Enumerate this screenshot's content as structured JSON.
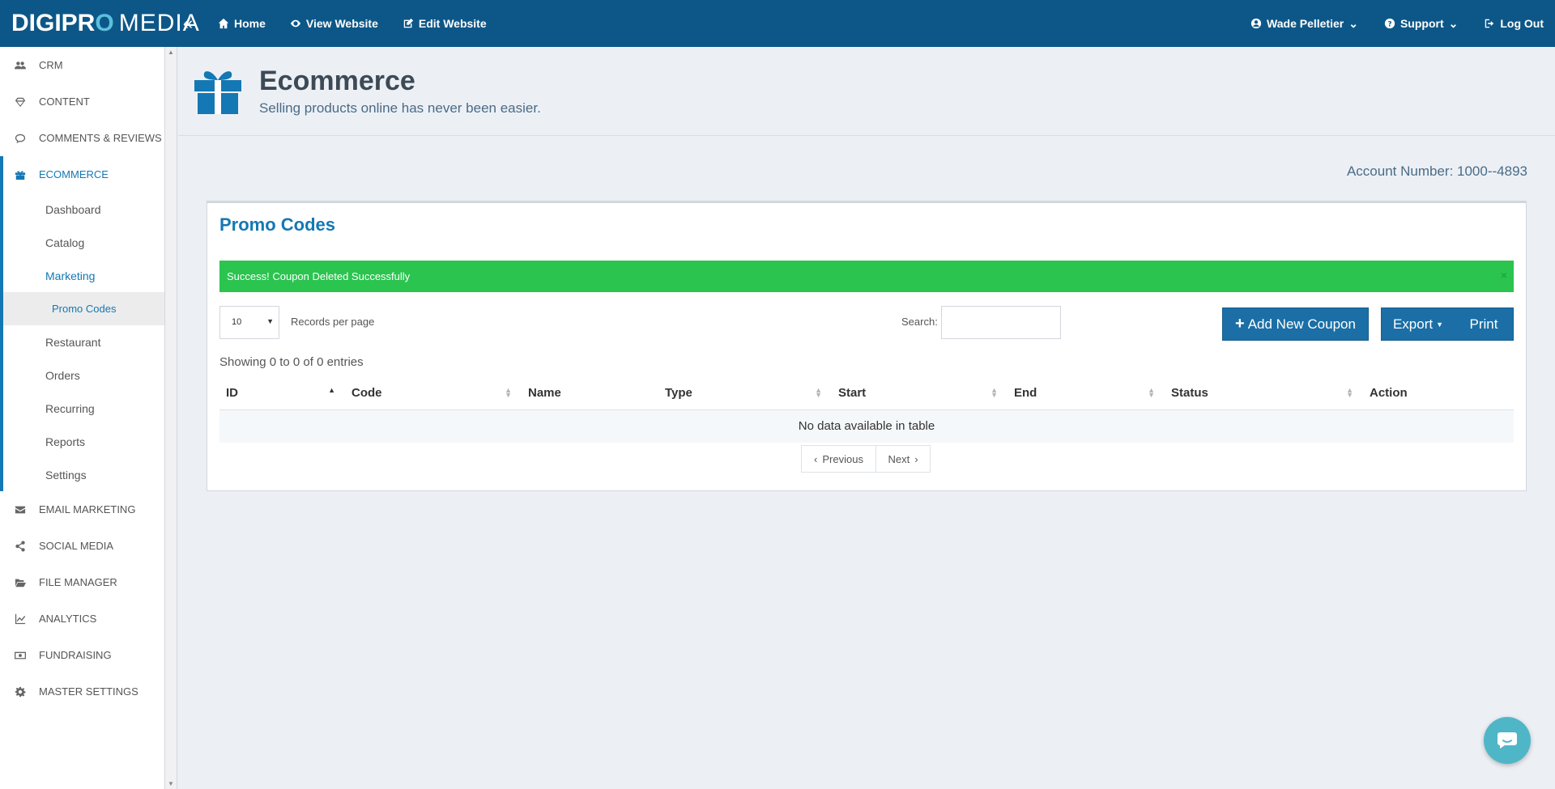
{
  "logo": {
    "part1": "DIGIPR",
    "part2": "O",
    "part3": "MEDIA"
  },
  "topnav": {
    "home": "Home",
    "view_website": "View Website",
    "edit_website": "Edit Website"
  },
  "user": {
    "name": "Wade Pelletier",
    "support": "Support",
    "logout": "Log Out"
  },
  "sidebar": {
    "items": [
      "CRM",
      "CONTENT",
      "COMMENTS & REVIEWS",
      "ECOMMERCE",
      "EMAIL MARKETING",
      "SOCIAL MEDIA",
      "FILE MANAGER",
      "ANALYTICS",
      "FUNDRAISING",
      "MASTER SETTINGS"
    ],
    "sub": [
      "Dashboard",
      "Catalog",
      "Marketing",
      "Promo Codes",
      "Restaurant",
      "Orders",
      "Recurring",
      "Reports",
      "Settings"
    ]
  },
  "header": {
    "title": "Ecommerce",
    "subtitle": "Selling products online has never been easier."
  },
  "account": "Account Number: 1000--4893",
  "panel": {
    "title": "Promo Codes",
    "alert": "Success! Coupon Deleted Successfully",
    "alert_close": "×",
    "per_page_value": "10",
    "per_page_label": "Records per page",
    "search_label": "Search:",
    "add_button": "Add New Coupon",
    "export_button": "Export",
    "print_button": "Print",
    "showing": "Showing 0 to 0 of 0 entries",
    "columns": [
      "ID",
      "Code",
      "Name",
      "Type",
      "Start",
      "End",
      "Status",
      "Action"
    ],
    "empty": "No data available in table",
    "prev": "Previous",
    "next": "Next"
  }
}
